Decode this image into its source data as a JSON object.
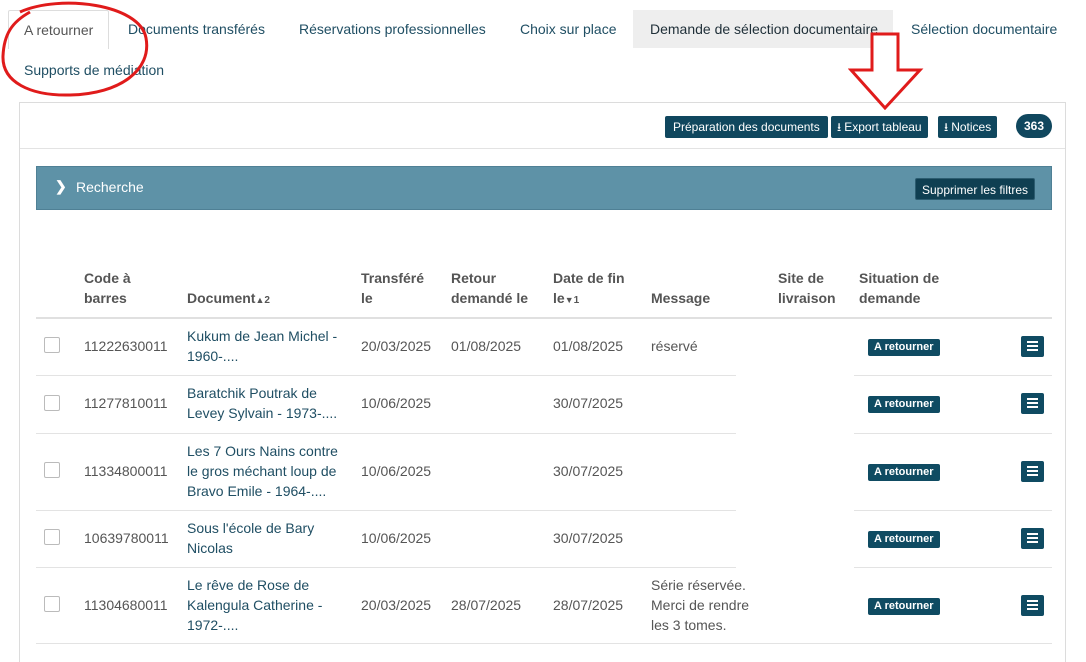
{
  "tabs": [
    "A retourner",
    "Documents transférés",
    "Réservations professionnelles",
    "Choix sur place",
    "Demande de sélection documentaire",
    "Sélection documentaire",
    "Supports de médiation"
  ],
  "toolbar": {
    "prep_label": "Préparation des documents",
    "export_label": "Export tableau",
    "notices_label": "Notices",
    "count": "363"
  },
  "search": {
    "label": "Recherche",
    "clear_label": "Supprimer les filtres"
  },
  "columns": {
    "barcode": [
      "Code à",
      "barres"
    ],
    "document": "Document",
    "document_sort_order": "2",
    "transferred": [
      "Transféré",
      "le"
    ],
    "return_requested": [
      "Retour",
      "demandé le"
    ],
    "end_date": [
      "Date de fin",
      "le"
    ],
    "end_date_sort_order": "1",
    "message": "Message",
    "delivery_site": [
      "Site de",
      "livraison"
    ],
    "request_status": [
      "Situation de",
      "demande"
    ]
  },
  "rows": [
    {
      "barcode": "11222630011",
      "document": [
        "Kukum de Jean Michel -",
        "1960-...."
      ],
      "transferred": "20/03/2025",
      "return_requested": "01/08/2025",
      "end_date": "01/08/2025",
      "message": [
        "réservé"
      ],
      "status": "A retourner"
    },
    {
      "barcode": "11277810011",
      "document": [
        "Baratchik Poutrak de",
        "Levey Sylvain - 1973-...."
      ],
      "transferred": "10/06/2025",
      "return_requested": "",
      "end_date": "30/07/2025",
      "message": [],
      "status": "A retourner"
    },
    {
      "barcode": "11334800011",
      "document": [
        "Les 7 Ours Nains contre",
        "le gros méchant loup de",
        "Bravo Emile - 1964-...."
      ],
      "transferred": "10/06/2025",
      "return_requested": "",
      "end_date": "30/07/2025",
      "message": [],
      "status": "A retourner"
    },
    {
      "barcode": "10639780011",
      "document": [
        "Sous l'école de Bary",
        "Nicolas"
      ],
      "transferred": "10/06/2025",
      "return_requested": "",
      "end_date": "30/07/2025",
      "message": [],
      "status": "A retourner"
    },
    {
      "barcode": "11304680011",
      "document": [
        "Le rêve de Rose de",
        "Kalengula Catherine -",
        "1972-...."
      ],
      "transferred": "20/03/2025",
      "return_requested": "28/07/2025",
      "end_date": "28/07/2025",
      "message": [
        "Série réservée.",
        "Merci de rendre",
        "les 3 tomes."
      ],
      "status": "A retourner"
    }
  ],
  "colors": {
    "brand_dark": "#10475e",
    "search_bar": "#5e92a7",
    "annotation_red": "#e01b1b"
  },
  "icons": {
    "search_toggle": "chevron-right-icon",
    "download": "download-icon",
    "row_menu": "list-icon"
  }
}
